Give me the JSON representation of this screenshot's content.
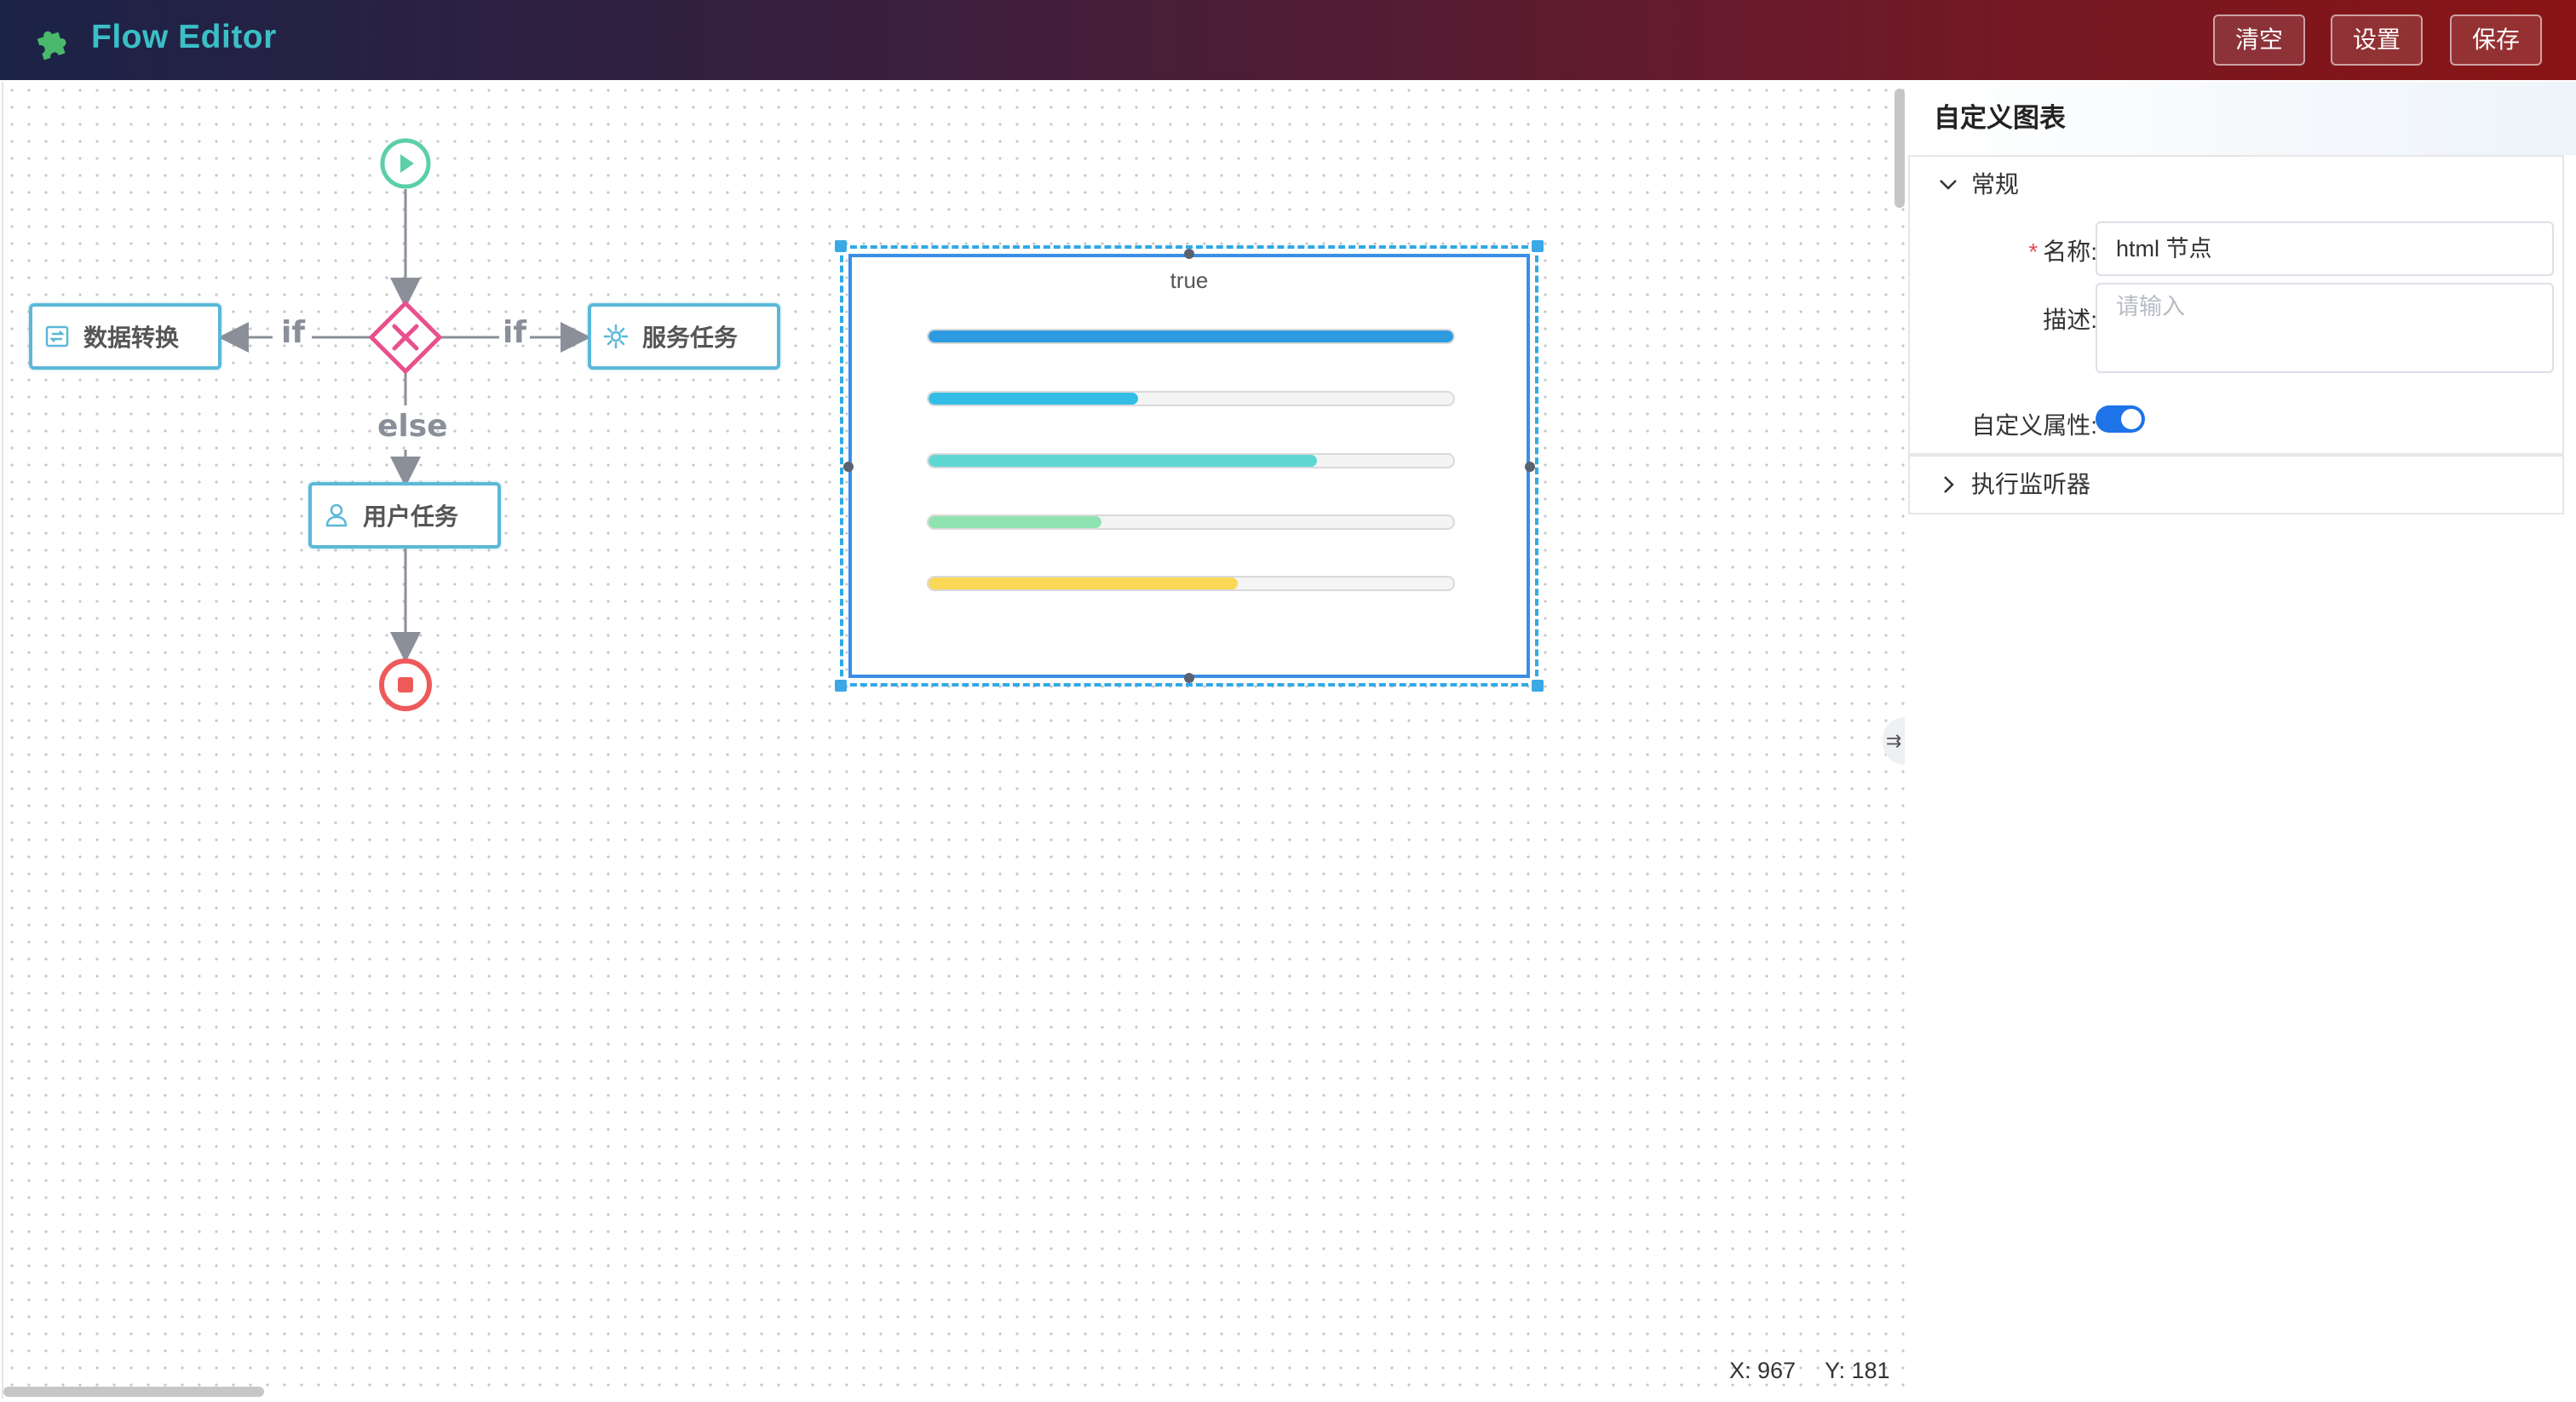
{
  "header": {
    "title": "Flow Editor",
    "logo_icon": "puzzle-icon",
    "buttons": {
      "clear": "清空",
      "settings": "设置",
      "save": "保存"
    }
  },
  "canvas": {
    "nodes": {
      "data_transform": "数据转换",
      "service_task": "服务任务",
      "user_task": "用户任务"
    },
    "edges": {
      "if_left": "if",
      "if_right": "if",
      "else": "else"
    },
    "html_node": {
      "label": "true",
      "bars": [
        {
          "value": 1.0,
          "color": "#2e9be0"
        },
        {
          "value": 0.4,
          "color": "#33bde6"
        },
        {
          "value": 0.74,
          "color": "#5fd8d4"
        },
        {
          "value": 0.33,
          "color": "#8fe3b0"
        },
        {
          "value": 0.59,
          "color": "#fbd756"
        }
      ]
    },
    "coords": {
      "x": "X: 967",
      "y": "Y: 181"
    }
  },
  "panel": {
    "title": "自定义图表",
    "general_section": "常规",
    "name_label": "名称:",
    "name_value": "html 节点",
    "desc_label": "描述:",
    "desc_placeholder": "请输入",
    "custom_attr_label": "自定义属性:",
    "custom_attr_on": true,
    "listener_section": "执行监听器"
  }
}
